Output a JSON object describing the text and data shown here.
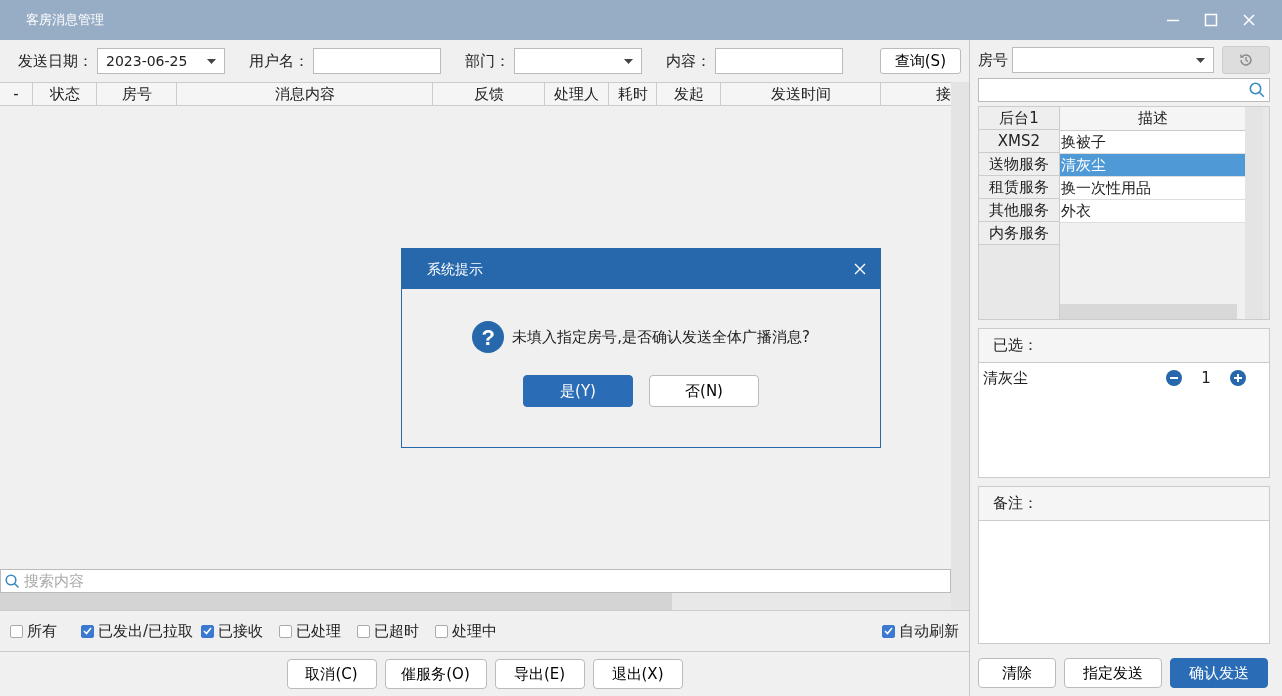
{
  "window": {
    "title": "客房消息管理"
  },
  "filters": [
    {
      "label": "发送日期：",
      "kind": "select",
      "value": "2023-06-25"
    },
    {
      "label": "用户名：",
      "kind": "text"
    },
    {
      "label": "部门：",
      "kind": "select"
    },
    {
      "label": "内容：",
      "kind": "text"
    }
  ],
  "query_button": "查询(S)",
  "table": {
    "columns": [
      "-",
      "状态",
      "房号",
      "消息内容",
      "反馈",
      "处理人",
      "耗时",
      "发起",
      "发送时间",
      "接"
    ]
  },
  "search": {
    "placeholder": "搜索内容"
  },
  "status_filters": [
    {
      "label": "所有",
      "checked": false
    },
    {
      "label": "已发出/已拉取",
      "checked": true
    },
    {
      "label": "已接收",
      "checked": true
    },
    {
      "label": "已处理",
      "checked": false
    },
    {
      "label": "已超时",
      "checked": false
    },
    {
      "label": "处理中",
      "checked": false
    }
  ],
  "auto_refresh": {
    "label": "自动刷新",
    "checked": true
  },
  "bottom_buttons": [
    "取消(C)",
    "催服务(O)",
    "导出(E)",
    "退出(X)"
  ],
  "room": {
    "label": "房号"
  },
  "categories": [
    "后台1",
    "XMS2",
    "送物服务",
    "租赁服务",
    "其他服务",
    "内务服务"
  ],
  "services": {
    "column": "描述",
    "items": [
      {
        "label": "换被子",
        "selected": false
      },
      {
        "label": "清灰尘",
        "selected": true
      },
      {
        "label": "换一次性用品",
        "selected": false
      },
      {
        "label": "外衣",
        "selected": false
      }
    ]
  },
  "selected_panel": {
    "title": "已选：",
    "items": [
      {
        "name": "清灰尘",
        "quantity": "1"
      }
    ]
  },
  "remarks": {
    "title": "备注："
  },
  "actions": [
    {
      "label": "清除",
      "primary": false
    },
    {
      "label": "指定发送",
      "primary": false
    },
    {
      "label": "确认发送",
      "primary": true
    }
  ],
  "dialog": {
    "title": "系统提示",
    "icon": "?",
    "message": "未填入指定房号,是否确认发送全体广播消息?",
    "buttons": [
      {
        "label": "是(Y)",
        "primary": true
      },
      {
        "label": "否(N)",
        "primary": false
      }
    ]
  }
}
